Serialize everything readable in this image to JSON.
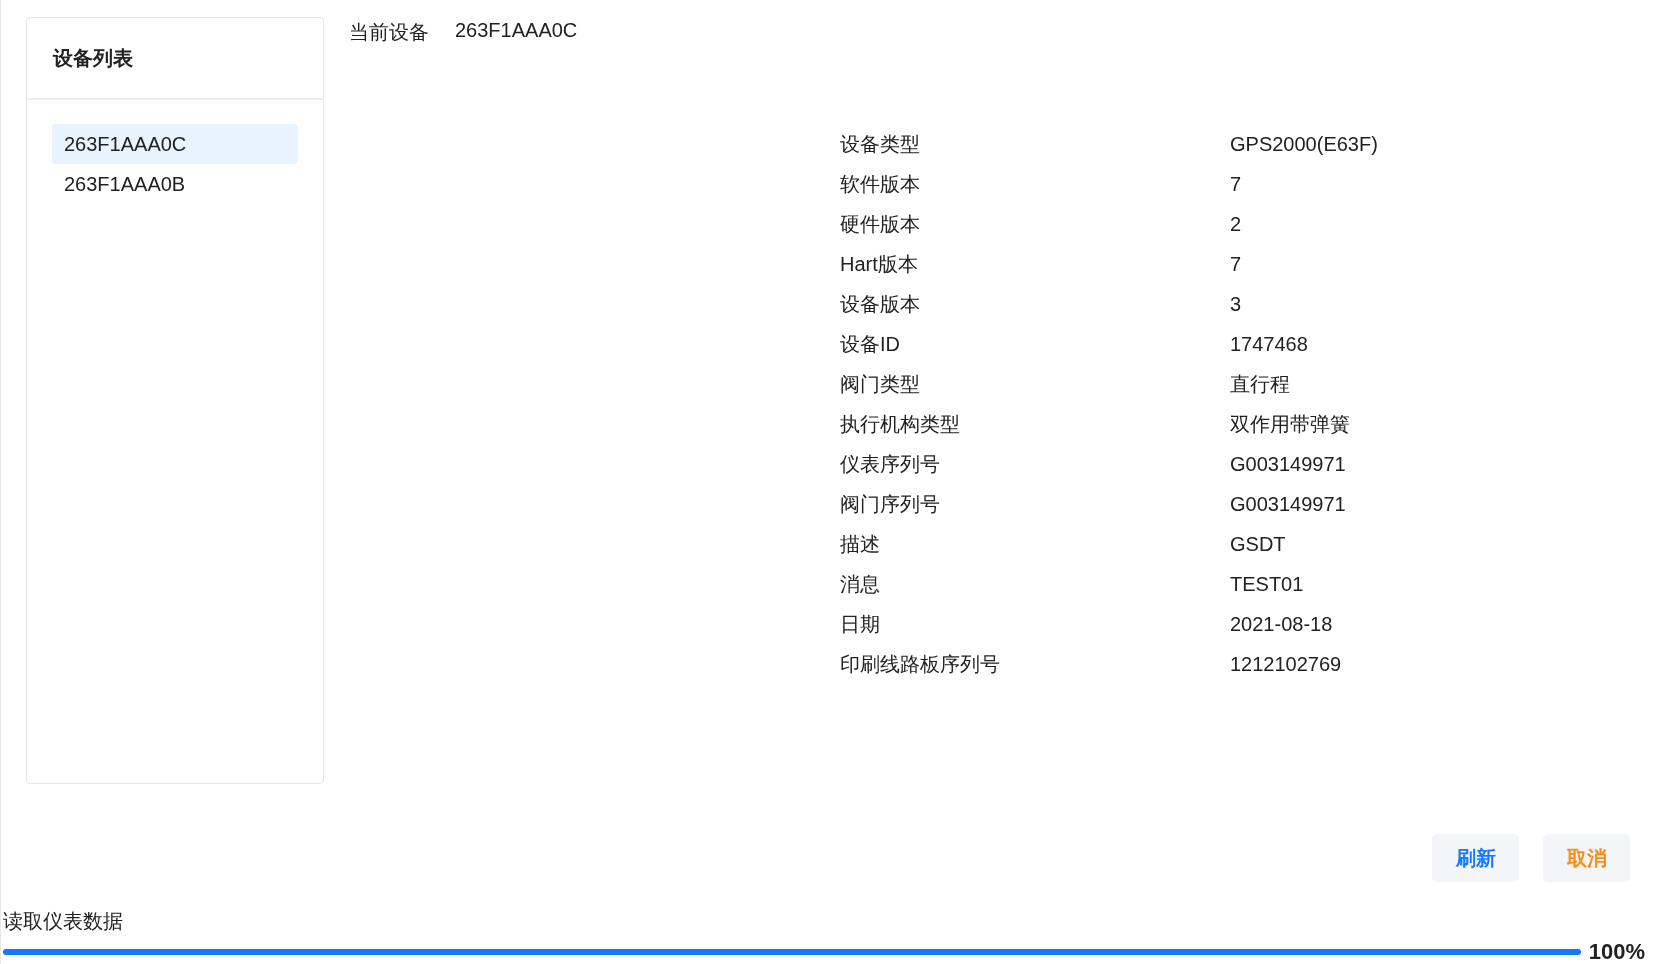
{
  "sidebar": {
    "title": "设备列表",
    "items": [
      {
        "label": "263F1AAA0C",
        "selected": true
      },
      {
        "label": "263F1AAA0B",
        "selected": false
      }
    ]
  },
  "current_device": {
    "label": "当前设备",
    "value": "263F1AAA0C"
  },
  "properties": [
    {
      "label": "设备类型",
      "value": "GPS2000(E63F)"
    },
    {
      "label": "软件版本",
      "value": "7"
    },
    {
      "label": "硬件版本",
      "value": "2"
    },
    {
      "label": "Hart版本",
      "value": "7"
    },
    {
      "label": "设备版本",
      "value": "3"
    },
    {
      "label": "设备ID",
      "value": "1747468"
    },
    {
      "label": "阀门类型",
      "value": "直行程"
    },
    {
      "label": "执行机构类型",
      "value": "双作用带弹簧"
    },
    {
      "label": "仪表序列号",
      "value": "G003149971"
    },
    {
      "label": "阀门序列号",
      "value": "G003149971"
    },
    {
      "label": "描述",
      "value": "GSDT"
    },
    {
      "label": "消息",
      "value": "TEST01"
    },
    {
      "label": "日期",
      "value": "2021-08-18"
    },
    {
      "label": "印刷线路板序列号",
      "value": "1212102769"
    }
  ],
  "buttons": [
    {
      "label": "刷新",
      "kind": "primary"
    },
    {
      "label": "取消",
      "kind": "cancel"
    }
  ],
  "status": {
    "text": "读取仪表数据",
    "level": 1,
    "reading": "100%"
  }
}
